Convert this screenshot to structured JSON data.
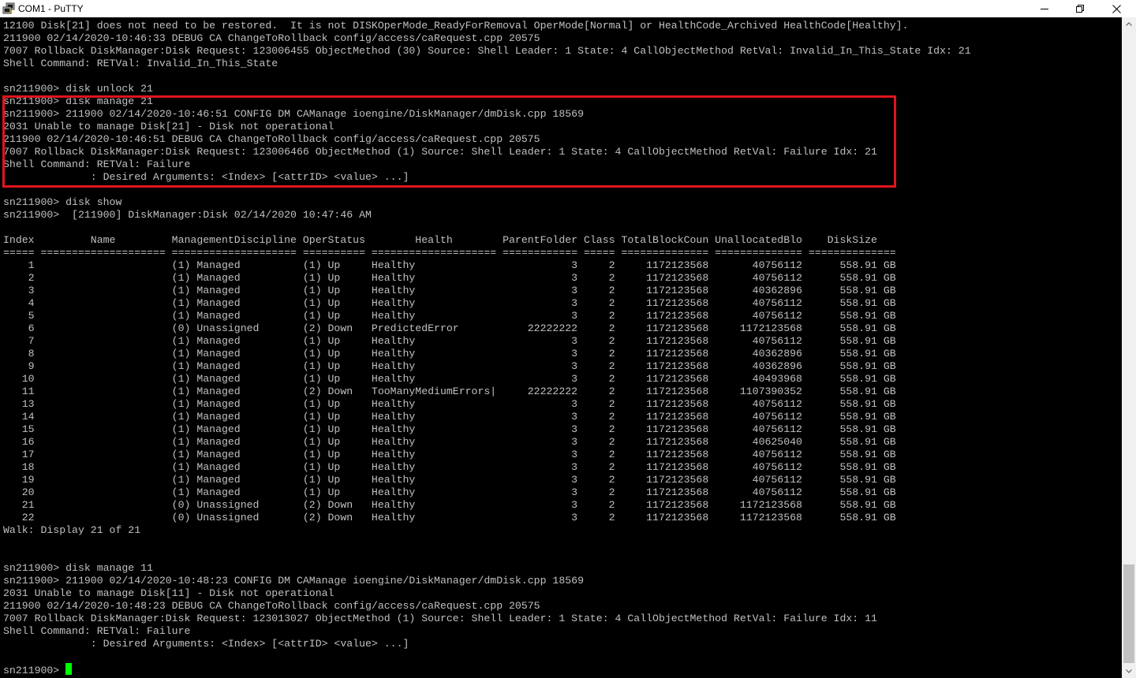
{
  "window": {
    "title": "COM1 - PuTTY",
    "icon": "putty-icon",
    "controls": [
      "minimize-icon",
      "maximize-icon",
      "close-icon"
    ]
  },
  "colors": {
    "background": "#000000",
    "text": "#c0c0c0",
    "cursor": "#00ff00",
    "highlight_border": "#e0141e"
  },
  "terminal": {
    "lines": [
      "12100 Disk[21] does not need to be restored.  It is not DISKOperMode_ReadyForRemoval OperMode[Normal] or HealthCode_Archived HealthCode[Healthy].",
      "211900 02/14/2020-10:46:33 DEBUG CA ChangeToRollback config/access/caRequest.cpp 20575",
      "7007 Rollback DiskManager:Disk Request: 123006455 ObjectMethod (30) Source: Shell Leader: 1 State: 4 CallObjectMethod RetVal: Invalid_In_This_State Idx: 21",
      "Shell Command: RETVal: Invalid_In_This_State",
      "",
      "sn211900> disk unlock 21",
      "sn211900> disk manage 21",
      "sn211900> 211900 02/14/2020-10:46:51 CONFIG DM CAManage ioengine/DiskManager/dmDisk.cpp 18569",
      "2031 Unable to manage Disk[21] - Disk not operational",
      "211900 02/14/2020-10:46:51 DEBUG CA ChangeToRollback config/access/caRequest.cpp 20575",
      "7007 Rollback DiskManager:Disk Request: 123006466 ObjectMethod (1) Source: Shell Leader: 1 State: 4 CallObjectMethod RetVal: Failure Idx: 21",
      "Shell Command: RETVal: Failure",
      "              : Desired Arguments: <Index> [<attrID> <value> ...]",
      "",
      "sn211900> disk show",
      "sn211900>  [211900] DiskManager:Disk 02/14/2020 10:47:46 AM",
      "",
      "Index         Name         ManagementDiscipline OperStatus        Health        ParentFolder Class TotalBlockCoun UnallocatedBlo    DiskSize",
      "===== ==================== ==================== ========== ==================== ============ ===== ============== ============== ==============",
      "    1                      (1) Managed          (1) Up     Healthy                         3     2     1172123568       40756112      558.91 GB",
      "    2                      (1) Managed          (1) Up     Healthy                         3     2     1172123568       40756112      558.91 GB",
      "    3                      (1) Managed          (1) Up     Healthy                         3     2     1172123568       40362896      558.91 GB",
      "    4                      (1) Managed          (1) Up     Healthy                         3     2     1172123568       40756112      558.91 GB",
      "    5                      (1) Managed          (1) Up     Healthy                         3     2     1172123568       40756112      558.91 GB",
      "    6                      (0) Unassigned       (2) Down   PredictedError           22222222     2     1172123568     1172123568      558.91 GB",
      "    7                      (1) Managed          (1) Up     Healthy                         3     2     1172123568       40756112      558.91 GB",
      "    8                      (1) Managed          (1) Up     Healthy                         3     2     1172123568       40362896      558.91 GB",
      "    9                      (1) Managed          (1) Up     Healthy                         3     2     1172123568       40362896      558.91 GB",
      "   10                      (1) Managed          (1) Up     Healthy                         3     2     1172123568       40493968      558.91 GB",
      "   11                      (1) Managed          (2) Down   TooManyMediumErrors|     22222222     2     1172123568     1107390352      558.91 GB",
      "   13                      (1) Managed          (1) Up     Healthy                         3     2     1172123568       40756112      558.91 GB",
      "   14                      (1) Managed          (1) Up     Healthy                         3     2     1172123568       40756112      558.91 GB",
      "   15                      (1) Managed          (1) Up     Healthy                         3     2     1172123568       40756112      558.91 GB",
      "   16                      (1) Managed          (1) Up     Healthy                         3     2     1172123568       40625040      558.91 GB",
      "   17                      (1) Managed          (1) Up     Healthy                         3     2     1172123568       40756112      558.91 GB",
      "   18                      (1) Managed          (1) Up     Healthy                         3     2     1172123568       40756112      558.91 GB",
      "   19                      (1) Managed          (1) Up     Healthy                         3     2     1172123568       40756112      558.91 GB",
      "   20                      (1) Managed          (1) Up     Healthy                         3     2     1172123568       40756112      558.91 GB",
      "   21                      (0) Unassigned       (2) Down   Healthy                         3     2     1172123568     1172123568      558.91 GB",
      "   22                      (0) Unassigned       (2) Down   Healthy                         3     2     1172123568     1172123568      558.91 GB",
      "Walk: Display 21 of 21",
      "",
      "",
      "sn211900> disk manage 11",
      "sn211900> 211900 02/14/2020-10:48:23 CONFIG DM CAManage ioengine/DiskManager/dmDisk.cpp 18569",
      "2031 Unable to manage Disk[11] - Disk not operational",
      "211900 02/14/2020-10:48:23 DEBUG CA ChangeToRollback config/access/caRequest.cpp 20575",
      "7007 Rollback DiskManager:Disk Request: 123013027 ObjectMethod (1) Source: Shell Leader: 1 State: 4 CallObjectMethod RetVal: Failure Idx: 11",
      "Shell Command: RETVal: Failure",
      "              : Desired Arguments: <Index> [<attrID> <value> ...]",
      "",
      "sn211900> "
    ]
  }
}
